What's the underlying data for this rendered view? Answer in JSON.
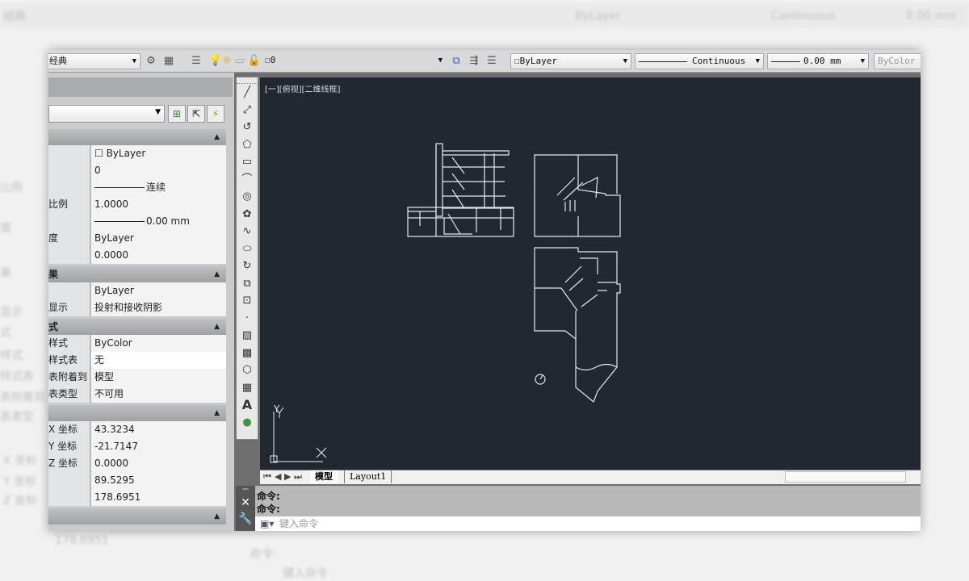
{
  "toolbar": {
    "workspace": "经典",
    "layer": "0",
    "color": "ByLayer",
    "linetype": "Continuous",
    "lineweight": "0.00 mm",
    "plotstyle": "ByColor"
  },
  "viewport_label": "[一][俯视][二维线框]",
  "properties": {
    "sections": [
      {
        "rows": [
          {
            "label": "",
            "value": "ByLayer",
            "swatch": true
          },
          {
            "label": "",
            "value": "0"
          },
          {
            "label": "",
            "value": "连续",
            "line": true
          },
          {
            "label": "比例",
            "value": "1.0000"
          },
          {
            "label": "",
            "value": "0.00 mm",
            "line": true
          },
          {
            "label": "度",
            "value": "ByLayer"
          },
          {
            "label": "",
            "value": "0.0000"
          }
        ]
      },
      {
        "title": "果",
        "rows": [
          {
            "label": "",
            "value": "ByLayer"
          },
          {
            "label": "显示",
            "value": "投射和接收阴影"
          }
        ]
      },
      {
        "title": "式",
        "rows": [
          {
            "label": "样式",
            "value": "ByColor"
          },
          {
            "label": "样式表",
            "value": "无",
            "white": true
          },
          {
            "label": "表附着到",
            "value": "模型"
          },
          {
            "label": "表类型",
            "value": "不可用"
          }
        ]
      },
      {
        "title": "",
        "rows": [
          {
            "label": "X 坐标",
            "value": "43.3234"
          },
          {
            "label": "Y 坐标",
            "value": "-21.7147"
          },
          {
            "label": "Z 坐标",
            "value": "0.0000"
          },
          {
            "label": "",
            "value": "89.5295"
          },
          {
            "label": "",
            "value": "178.6951"
          }
        ]
      },
      {
        "title": "",
        "rows": []
      }
    ]
  },
  "draw_tools": [
    "line",
    "polyline",
    "3d-polyline",
    "polygon",
    "rectangle",
    "arc",
    "circle",
    "revision-cloud",
    "spline",
    "ellipse",
    "ellipse-arc",
    "insert-block",
    "make-block",
    "point",
    "hatch",
    "gradient",
    "region",
    "table",
    "multiline-text",
    "add-selected"
  ],
  "ucs": {
    "x": "X",
    "y": "Y"
  },
  "tabs": {
    "model": "模型",
    "layout1": "Layout1"
  },
  "command": {
    "lines": [
      "命令:",
      "命令:"
    ],
    "placeholder": "键入命令"
  },
  "background": {
    "workspace": "经典",
    "color": "ByLayer",
    "linetype": "Continuous",
    "lineweight": "0.00 mm",
    "labels": [
      "比例",
      "度",
      "果",
      "显示",
      "式",
      "样式",
      "样式表",
      "表附着到",
      "表类型",
      "X 坐标",
      "Y 坐标",
      "Z 坐标"
    ],
    "value": "178.6951",
    "cmd": "命令:",
    "placeholder": "键入命令"
  }
}
